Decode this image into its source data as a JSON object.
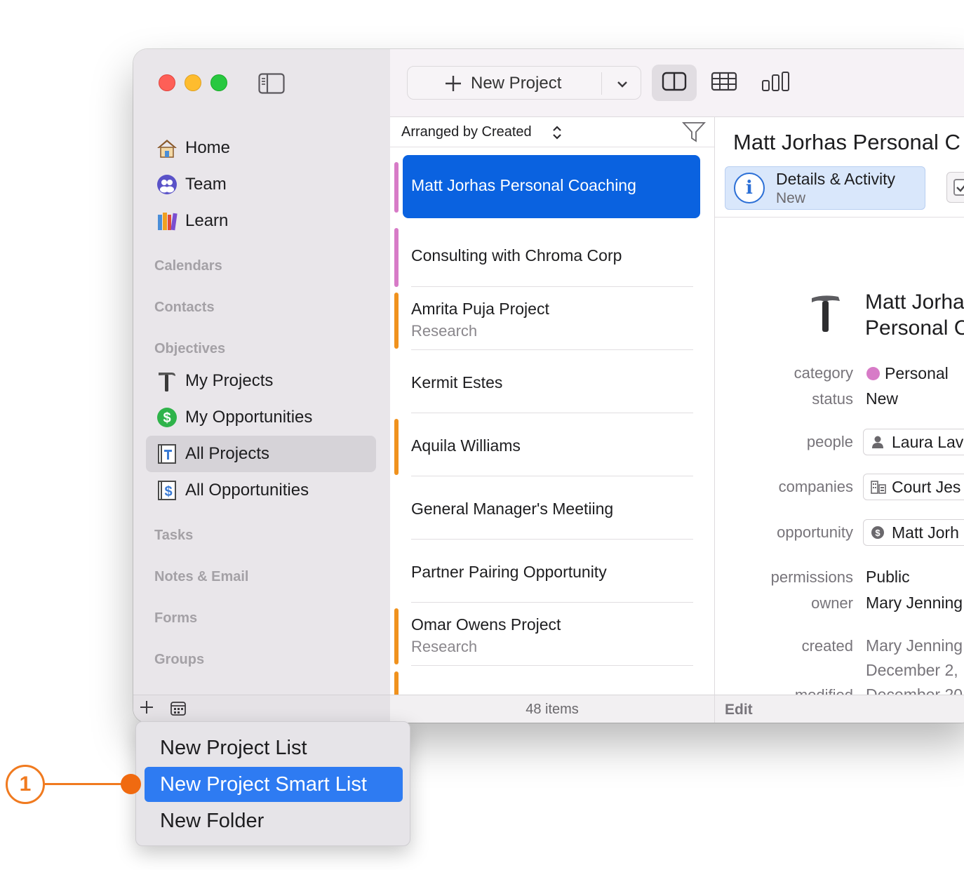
{
  "sidebar": {
    "nav": [
      {
        "label": "Home",
        "icon": "home-icon"
      },
      {
        "label": "Team",
        "icon": "team-icon"
      },
      {
        "label": "Learn",
        "icon": "books-icon"
      }
    ],
    "sections": {
      "calendars": "Calendars",
      "contacts": "Contacts",
      "objectives": "Objectives",
      "tasks": "Tasks",
      "notes_email": "Notes & Email",
      "forms": "Forms",
      "groups": "Groups"
    },
    "objectives_items": [
      {
        "label": "My Projects",
        "icon": "hammer-icon"
      },
      {
        "label": "My Opportunities",
        "icon": "dollar-coin-icon"
      },
      {
        "label": "All Projects",
        "icon": "project-list-icon",
        "selected": true
      },
      {
        "label": "All Opportunities",
        "icon": "opportunity-list-icon"
      }
    ]
  },
  "toolbar": {
    "new_project_label": "New Project"
  },
  "list": {
    "arranged_label": "Arranged by Created",
    "rows": [
      {
        "title": "Matt Jorhas Personal Coaching",
        "subtitle": "",
        "bar_color": "#d77bc7",
        "selected": true
      },
      {
        "title": "Consulting with Chroma Corp",
        "subtitle": "",
        "bar_color": "#d77bc7"
      },
      {
        "title": "Amrita Puja Project",
        "subtitle": "Research",
        "bar_color": "#f0921e"
      },
      {
        "title": "Kermit Estes",
        "subtitle": "",
        "bar_color": ""
      },
      {
        "title": "Aquila Williams",
        "subtitle": "",
        "bar_color": "#f0921e"
      },
      {
        "title": "General Manager's Meetiing",
        "subtitle": "",
        "bar_color": ""
      },
      {
        "title": "Partner Pairing Opportunity",
        "subtitle": "",
        "bar_color": ""
      },
      {
        "title": "Omar Owens Project",
        "subtitle": "Research",
        "bar_color": "#f0921e"
      }
    ],
    "item_count": "48 items"
  },
  "detail": {
    "title": "Matt Jorhas Personal C",
    "tab": {
      "title": "Details & Activity",
      "subtitle": "New"
    },
    "record_name_line1": "Matt Jorha",
    "record_name_line2": "Personal C",
    "fields": {
      "category_label": "category",
      "category_value": "Personal",
      "category_color": "#d77bc7",
      "status_label": "status",
      "status_value": "New",
      "people_label": "people",
      "people_value": "Laura Lav",
      "companies_label": "companies",
      "companies_value": "Court Jes",
      "opportunity_label": "opportunity",
      "opportunity_value": "Matt Jorh",
      "permissions_label": "permissions",
      "permissions_value": "Public",
      "owner_label": "owner",
      "owner_value": "Mary Jenning",
      "created_label": "created",
      "created_value": "Mary Jenning",
      "created_date": "December 2,",
      "modified_label": "modified",
      "modified_value": "December 20"
    },
    "edit_label": "Edit"
  },
  "popup_menu": {
    "items": [
      {
        "label": "New Project List",
        "highlighted": false
      },
      {
        "label": "New Project Smart List",
        "highlighted": true
      },
      {
        "label": "New Folder",
        "highlighted": false
      }
    ]
  },
  "callout": {
    "number": "1",
    "color": "#f07a1f"
  }
}
